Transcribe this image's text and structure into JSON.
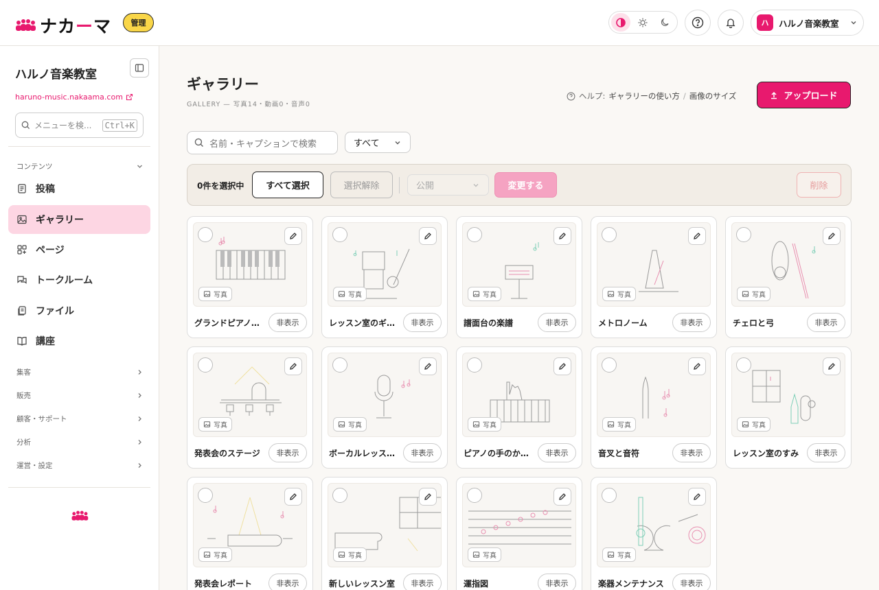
{
  "header": {
    "brand_left": "ナカ",
    "brand_accent": "ー",
    "brand_right": "マ",
    "admin_badge": "管理",
    "account_initial": "ハ",
    "account_name": "ハルノ音楽教室"
  },
  "sidebar": {
    "title": "ハルノ音楽教室",
    "url": "haruno-music.nakaama.com",
    "search_placeholder": "メニューを検...",
    "search_shortcut": "Ctrl+K",
    "group_contents": "コンテンツ",
    "items": [
      {
        "label": "投稿",
        "icon": "document-icon"
      },
      {
        "label": "ギャラリー",
        "icon": "image-icon",
        "active": true
      },
      {
        "label": "ページ",
        "icon": "pages-icon"
      },
      {
        "label": "トークルーム",
        "icon": "chat-icon"
      },
      {
        "label": "ファイル",
        "icon": "file-icon"
      },
      {
        "label": "講座",
        "icon": "book-icon"
      }
    ],
    "groups": [
      "集客",
      "販売",
      "顧客・サポート",
      "分析",
      "運営・設定"
    ]
  },
  "page": {
    "title": "ギャラリー",
    "subtitle": "GALLERY — 写真14・動画0・音声0",
    "help_prefix": "ヘルプ:",
    "help_link1": "ギャラリーの使い方",
    "help_sep": "/",
    "help_link2": "画像のサイズ",
    "upload_label": "アップロード",
    "search_placeholder": "名前・キャプションで検索",
    "filter_value": "すべて"
  },
  "selection": {
    "count_label": "0件を選択中",
    "select_all": "すべて選択",
    "deselect": "選択解除",
    "visibility_value": "公開",
    "apply": "変更する",
    "delete": "削除"
  },
  "card_common": {
    "type_label": "写真",
    "hide_label": "非表示"
  },
  "cards": [
    {
      "name": "グランドピアノ…"
    },
    {
      "name": "レッスン室のギ…"
    },
    {
      "name": "譜面台の楽譜"
    },
    {
      "name": "メトロノーム"
    },
    {
      "name": "チェロと弓"
    },
    {
      "name": "発表会のステージ"
    },
    {
      "name": "ボーカルレッス…"
    },
    {
      "name": "ピアノの手のか…"
    },
    {
      "name": "音叉と音符"
    },
    {
      "name": "レッスン室のすみ"
    },
    {
      "name": "発表会レポート"
    },
    {
      "name": "新しいレッスン室"
    },
    {
      "name": "運指図"
    },
    {
      "name": "楽器メンテナンス"
    }
  ],
  "colors": {
    "accent": "#e8196e",
    "badge": "#f9d648",
    "active_bg": "#fdd6e3"
  }
}
